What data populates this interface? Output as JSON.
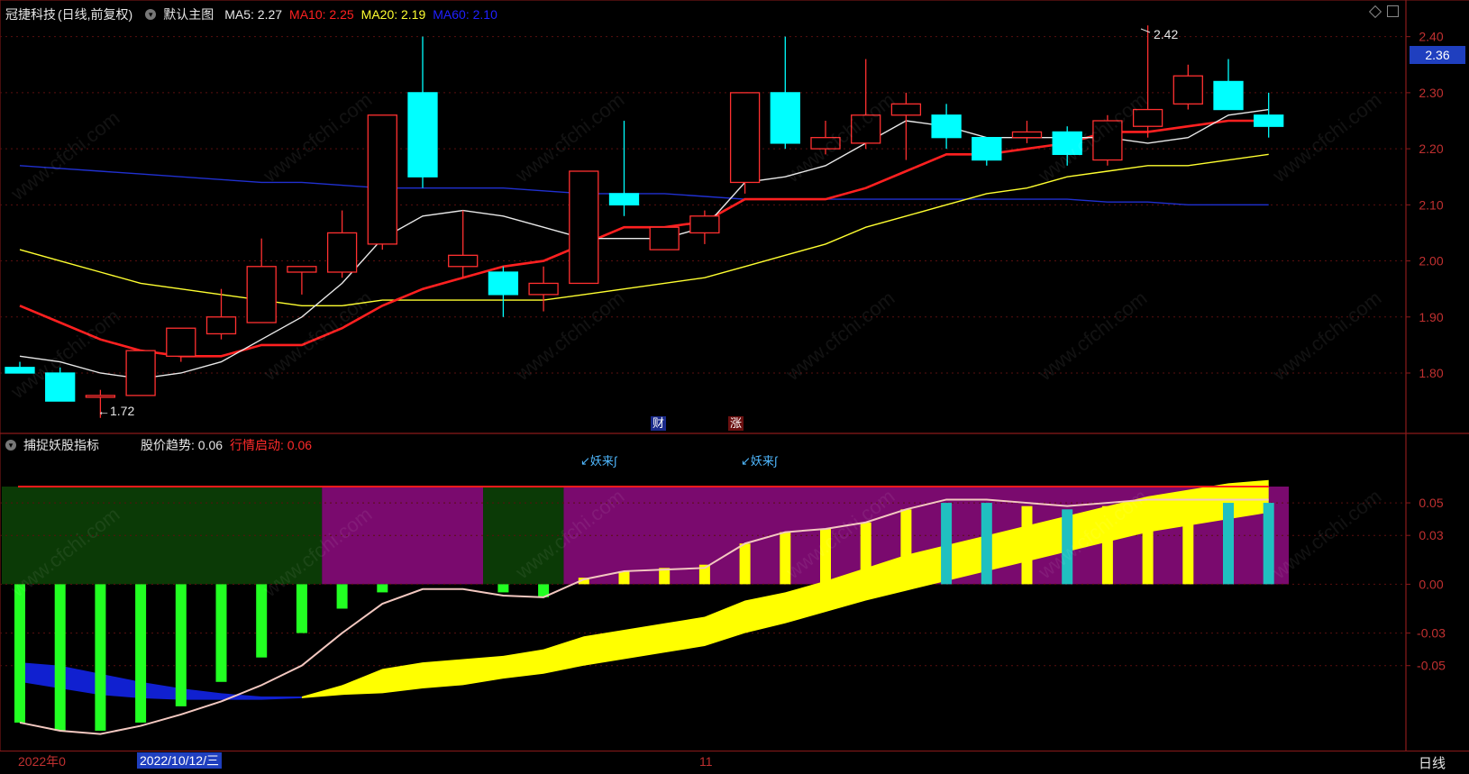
{
  "top_header": {
    "stock_name": "冠捷科技",
    "period_mode": "(日线,前复权)",
    "main_chart": "默认主图",
    "ma_items": [
      {
        "label": "MA5:",
        "value": "2.27",
        "color": "#e8e8e8"
      },
      {
        "label": "MA10:",
        "value": "2.25",
        "color": "#ff2020"
      },
      {
        "label": "MA20:",
        "value": "2.19",
        "color": "#ffff30"
      },
      {
        "label": "MA60:",
        "value": "2.10",
        "color": "#2020ff"
      }
    ]
  },
  "indicator_header": {
    "name": "捕捉妖股指标",
    "items": [
      {
        "label": "股价趋势:",
        "value": "0.06",
        "color": "#e6e6e6"
      },
      {
        "label": "行情启动:",
        "value": "0.06",
        "color": "#ff2a2a"
      }
    ]
  },
  "current_price": "2.36",
  "markers": {
    "cai": "财",
    "zhang": "涨",
    "yao1": "↙妖来∫",
    "yao2": "↙妖来∫"
  },
  "annotations": {
    "high": "2.42",
    "low": "←1.72"
  },
  "x_axis": {
    "year_label": "2022年0",
    "cursor_date": "2022/10/12/三",
    "month_label": "11"
  },
  "period_label": "日线",
  "watermark": "www.cfchi.com",
  "colors": {
    "up": "#ff3030",
    "down": "#00ffff",
    "ma5": "#e8e8e8",
    "ma10": "#ff2020",
    "ma20": "#ffff30",
    "ma60": "#2030d0",
    "green_bar": "#22ff22",
    "purple": "#7a0a6e",
    "dark_green": "#0b3a06",
    "yellow": "#ffff00",
    "teal": "#20c0c0"
  },
  "chart_data": [
    {
      "type": "candlestick",
      "title": "冠捷科技 (日线,前复权)",
      "ylim": [
        1.71,
        2.43
      ],
      "y_ticks": [
        "2.40",
        "2.30",
        "2.20",
        "2.10",
        "2.00",
        "1.90",
        "1.80"
      ],
      "ohlc": [
        [
          1.81,
          1.82,
          1.8,
          1.8
        ],
        [
          1.8,
          1.81,
          1.75,
          1.75
        ],
        [
          1.76,
          1.77,
          1.72,
          1.76
        ],
        [
          1.76,
          1.84,
          1.76,
          1.84
        ],
        [
          1.83,
          1.88,
          1.82,
          1.88
        ],
        [
          1.87,
          1.95,
          1.86,
          1.9
        ],
        [
          1.89,
          2.04,
          1.89,
          1.99
        ],
        [
          1.98,
          1.99,
          1.94,
          1.99
        ],
        [
          1.98,
          2.09,
          1.97,
          2.05
        ],
        [
          2.03,
          2.26,
          2.02,
          2.26
        ],
        [
          2.3,
          2.4,
          2.13,
          2.15
        ],
        [
          1.99,
          2.09,
          1.97,
          2.01
        ],
        [
          1.98,
          1.99,
          1.9,
          1.94
        ],
        [
          1.94,
          1.99,
          1.91,
          1.96
        ],
        [
          1.96,
          2.16,
          1.96,
          2.16
        ],
        [
          2.12,
          2.25,
          2.08,
          2.1
        ],
        [
          2.02,
          2.06,
          2.02,
          2.06
        ],
        [
          2.05,
          2.09,
          2.03,
          2.08
        ],
        [
          2.14,
          2.3,
          2.12,
          2.3
        ],
        [
          2.3,
          2.4,
          2.2,
          2.21
        ],
        [
          2.2,
          2.25,
          2.19,
          2.22
        ],
        [
          2.21,
          2.36,
          2.2,
          2.26
        ],
        [
          2.26,
          2.3,
          2.18,
          2.28
        ],
        [
          2.26,
          2.28,
          2.2,
          2.22
        ],
        [
          2.22,
          2.22,
          2.17,
          2.18
        ],
        [
          2.22,
          2.25,
          2.21,
          2.23
        ],
        [
          2.23,
          2.24,
          2.17,
          2.19
        ],
        [
          2.18,
          2.26,
          2.17,
          2.25
        ],
        [
          2.24,
          2.42,
          2.22,
          2.27
        ],
        [
          2.28,
          2.35,
          2.27,
          2.33
        ],
        [
          2.32,
          2.36,
          2.27,
          2.27
        ],
        [
          2.26,
          2.3,
          2.22,
          2.24
        ]
      ],
      "ma5": [
        1.83,
        1.82,
        1.8,
        1.79,
        1.8,
        1.82,
        1.86,
        1.9,
        1.96,
        2.04,
        2.08,
        2.09,
        2.08,
        2.06,
        2.04,
        2.04,
        2.04,
        2.06,
        2.14,
        2.15,
        2.17,
        2.21,
        2.25,
        2.24,
        2.22,
        2.22,
        2.22,
        2.22,
        2.21,
        2.22,
        2.26,
        2.27
      ],
      "ma10": [
        1.92,
        1.89,
        1.86,
        1.84,
        1.83,
        1.83,
        1.85,
        1.85,
        1.88,
        1.92,
        1.95,
        1.97,
        1.99,
        2.0,
        2.03,
        2.06,
        2.06,
        2.07,
        2.11,
        2.11,
        2.11,
        2.13,
        2.16,
        2.19,
        2.19,
        2.2,
        2.21,
        2.23,
        2.23,
        2.24,
        2.25,
        2.25
      ],
      "ma20": [
        2.02,
        2.0,
        1.98,
        1.96,
        1.95,
        1.94,
        1.93,
        1.92,
        1.92,
        1.93,
        1.93,
        1.93,
        1.93,
        1.93,
        1.94,
        1.95,
        1.96,
        1.97,
        1.99,
        2.01,
        2.03,
        2.06,
        2.08,
        2.1,
        2.12,
        2.13,
        2.15,
        2.16,
        2.17,
        2.17,
        2.18,
        2.19
      ],
      "ma60": [
        2.17,
        2.165,
        2.16,
        2.155,
        2.15,
        2.145,
        2.14,
        2.14,
        2.135,
        2.13,
        2.13,
        2.13,
        2.13,
        2.125,
        2.12,
        2.12,
        2.12,
        2.115,
        2.11,
        2.11,
        2.11,
        2.11,
        2.11,
        2.11,
        2.11,
        2.11,
        2.11,
        2.105,
        2.105,
        2.1,
        2.1,
        2.1
      ]
    },
    {
      "type": "bar",
      "title": "捕捉妖股指标",
      "ylim": [
        -0.095,
        0.06
      ],
      "y_ticks": [
        "0.05",
        "0.03",
        "0.00",
        "-0.03",
        "-0.05"
      ],
      "stick_values": [
        -0.085,
        -0.09,
        -0.09,
        -0.085,
        -0.075,
        -0.06,
        -0.045,
        -0.03,
        -0.015,
        -0.005,
        0.0,
        0.0,
        -0.005,
        -0.008,
        0.004,
        0.008,
        0.01,
        0.012,
        0.025,
        0.032,
        0.034,
        0.038,
        0.046,
        0.05,
        0.05,
        0.048,
        0.046,
        0.048,
        0.05,
        0.05,
        0.05,
        0.05
      ],
      "stick_colors": [
        "green",
        "green",
        "green",
        "green",
        "green",
        "green",
        "green",
        "green",
        "green",
        "green",
        "green",
        "green",
        "green",
        "green",
        "yellow",
        "yellow",
        "yellow",
        "yellow",
        "yellow",
        "yellow",
        "yellow",
        "yellow",
        "yellow",
        "teal",
        "teal",
        "yellow",
        "teal",
        "yellow",
        "yellow",
        "yellow",
        "teal",
        "teal"
      ],
      "line_values": [
        -0.085,
        -0.09,
        -0.092,
        -0.087,
        -0.08,
        -0.072,
        -0.062,
        -0.05,
        -0.03,
        -0.012,
        -0.003,
        -0.003,
        -0.007,
        -0.008,
        0.003,
        0.008,
        0.009,
        0.01,
        0.025,
        0.032,
        0.034,
        0.038,
        0.046,
        0.052,
        0.052,
        0.05,
        0.048,
        0.05,
        0.052,
        0.052,
        0.052,
        0.052
      ],
      "band_upper": [
        -0.048,
        -0.05,
        -0.055,
        -0.06,
        -0.064,
        -0.067,
        -0.069,
        -0.069,
        -0.062,
        -0.052,
        -0.048,
        -0.046,
        -0.044,
        -0.04,
        -0.032,
        -0.028,
        -0.024,
        -0.02,
        -0.01,
        -0.005,
        0.002,
        0.01,
        0.018,
        0.024,
        0.03,
        0.036,
        0.042,
        0.048,
        0.054,
        0.058,
        0.062,
        0.064
      ],
      "band_lower": [
        -0.06,
        -0.064,
        -0.068,
        -0.07,
        -0.071,
        -0.071,
        -0.071,
        -0.07,
        -0.068,
        -0.067,
        -0.064,
        -0.062,
        -0.058,
        -0.055,
        -0.05,
        -0.046,
        -0.042,
        -0.038,
        -0.03,
        -0.024,
        -0.017,
        -0.01,
        -0.004,
        0.002,
        0.008,
        0.014,
        0.02,
        0.026,
        0.032,
        0.036,
        0.04,
        0.044
      ],
      "band_colors_by_index": [
        "blue",
        "blue",
        "blue",
        "blue",
        "blue",
        "blue",
        "blue",
        "yellow",
        "yellow",
        "yellow",
        "yellow",
        "yellow",
        "yellow",
        "yellow",
        "yellow",
        "yellow",
        "yellow",
        "yellow",
        "yellow",
        "yellow",
        "yellow",
        "yellow",
        "yellow",
        "yellow",
        "yellow",
        "yellow",
        "yellow",
        "yellow",
        "yellow",
        "yellow",
        "yellow",
        "yellow"
      ],
      "background_blocks": [
        {
          "from": 0,
          "to": 7,
          "color": "dark_green"
        },
        {
          "from": 8,
          "to": 11,
          "color": "purple"
        },
        {
          "from": 12,
          "to": 13,
          "color": "dark_green"
        },
        {
          "from": 14,
          "to": 31,
          "color": "purple"
        }
      ],
      "threshold": 0.06
    }
  ]
}
